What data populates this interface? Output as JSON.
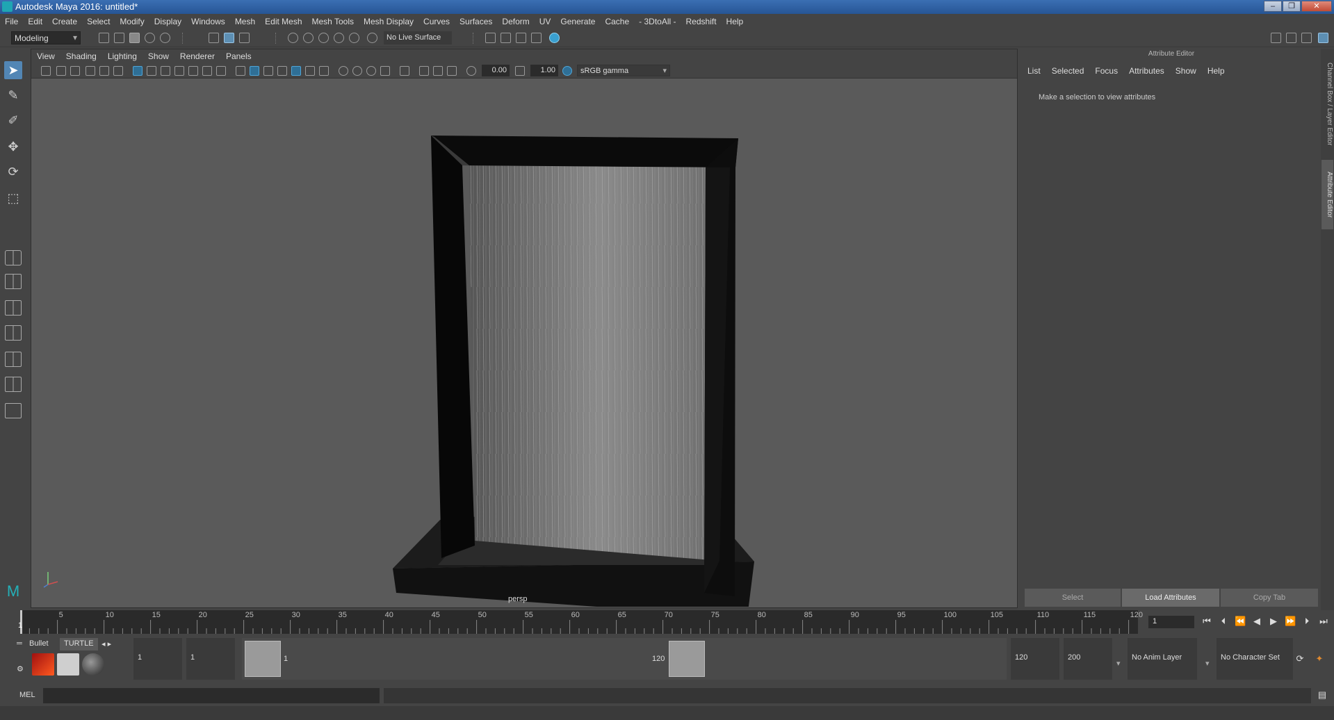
{
  "window": {
    "title": "Autodesk Maya 2016: untitled*"
  },
  "menubar": [
    "File",
    "Edit",
    "Create",
    "Select",
    "Modify",
    "Display",
    "Windows",
    "Mesh",
    "Edit Mesh",
    "Mesh Tools",
    "Mesh Display",
    "Curves",
    "Surfaces",
    "Deform",
    "UV",
    "Generate",
    "Cache",
    "- 3DtoAll -",
    "Redshift",
    "Help"
  ],
  "toolbar": {
    "mode": "Modeling",
    "live_surface": "No Live Surface"
  },
  "viewport": {
    "menu": [
      "View",
      "Shading",
      "Lighting",
      "Show",
      "Renderer",
      "Panels"
    ],
    "exposure": "0.00",
    "gamma_value": "1.00",
    "color_space": "sRGB gamma",
    "camera_label": "persp"
  },
  "attribute_editor": {
    "header": "Attribute Editor",
    "menu": [
      "List",
      "Selected",
      "Focus",
      "Attributes",
      "Show",
      "Help"
    ],
    "message": "Make a selection to view attributes",
    "buttons": {
      "select": "Select",
      "load": "Load Attributes",
      "copy": "Copy Tab"
    },
    "side_tabs": {
      "channel_box": "Channel Box / Layer Editor",
      "attribute_editor": "Attribute Editor"
    }
  },
  "timeslider": {
    "ticks": [
      "5",
      "10",
      "15",
      "20",
      "25",
      "30",
      "35",
      "40",
      "45",
      "50",
      "55",
      "60",
      "65",
      "70",
      "75",
      "80",
      "85",
      "90",
      "95",
      "100",
      "105",
      "110",
      "115",
      "120"
    ],
    "start_marker": "1",
    "current_frame": "1"
  },
  "range": {
    "start": "1",
    "start_inner": "1",
    "handle_start": "1",
    "handle_end": "120",
    "end_inner": "120",
    "end": "200",
    "anim_layer": "No Anim Layer",
    "character_set": "No Character Set"
  },
  "shelf": {
    "tabs": [
      "Bullet",
      "TURTLE"
    ]
  },
  "command_line": {
    "language": "MEL"
  }
}
